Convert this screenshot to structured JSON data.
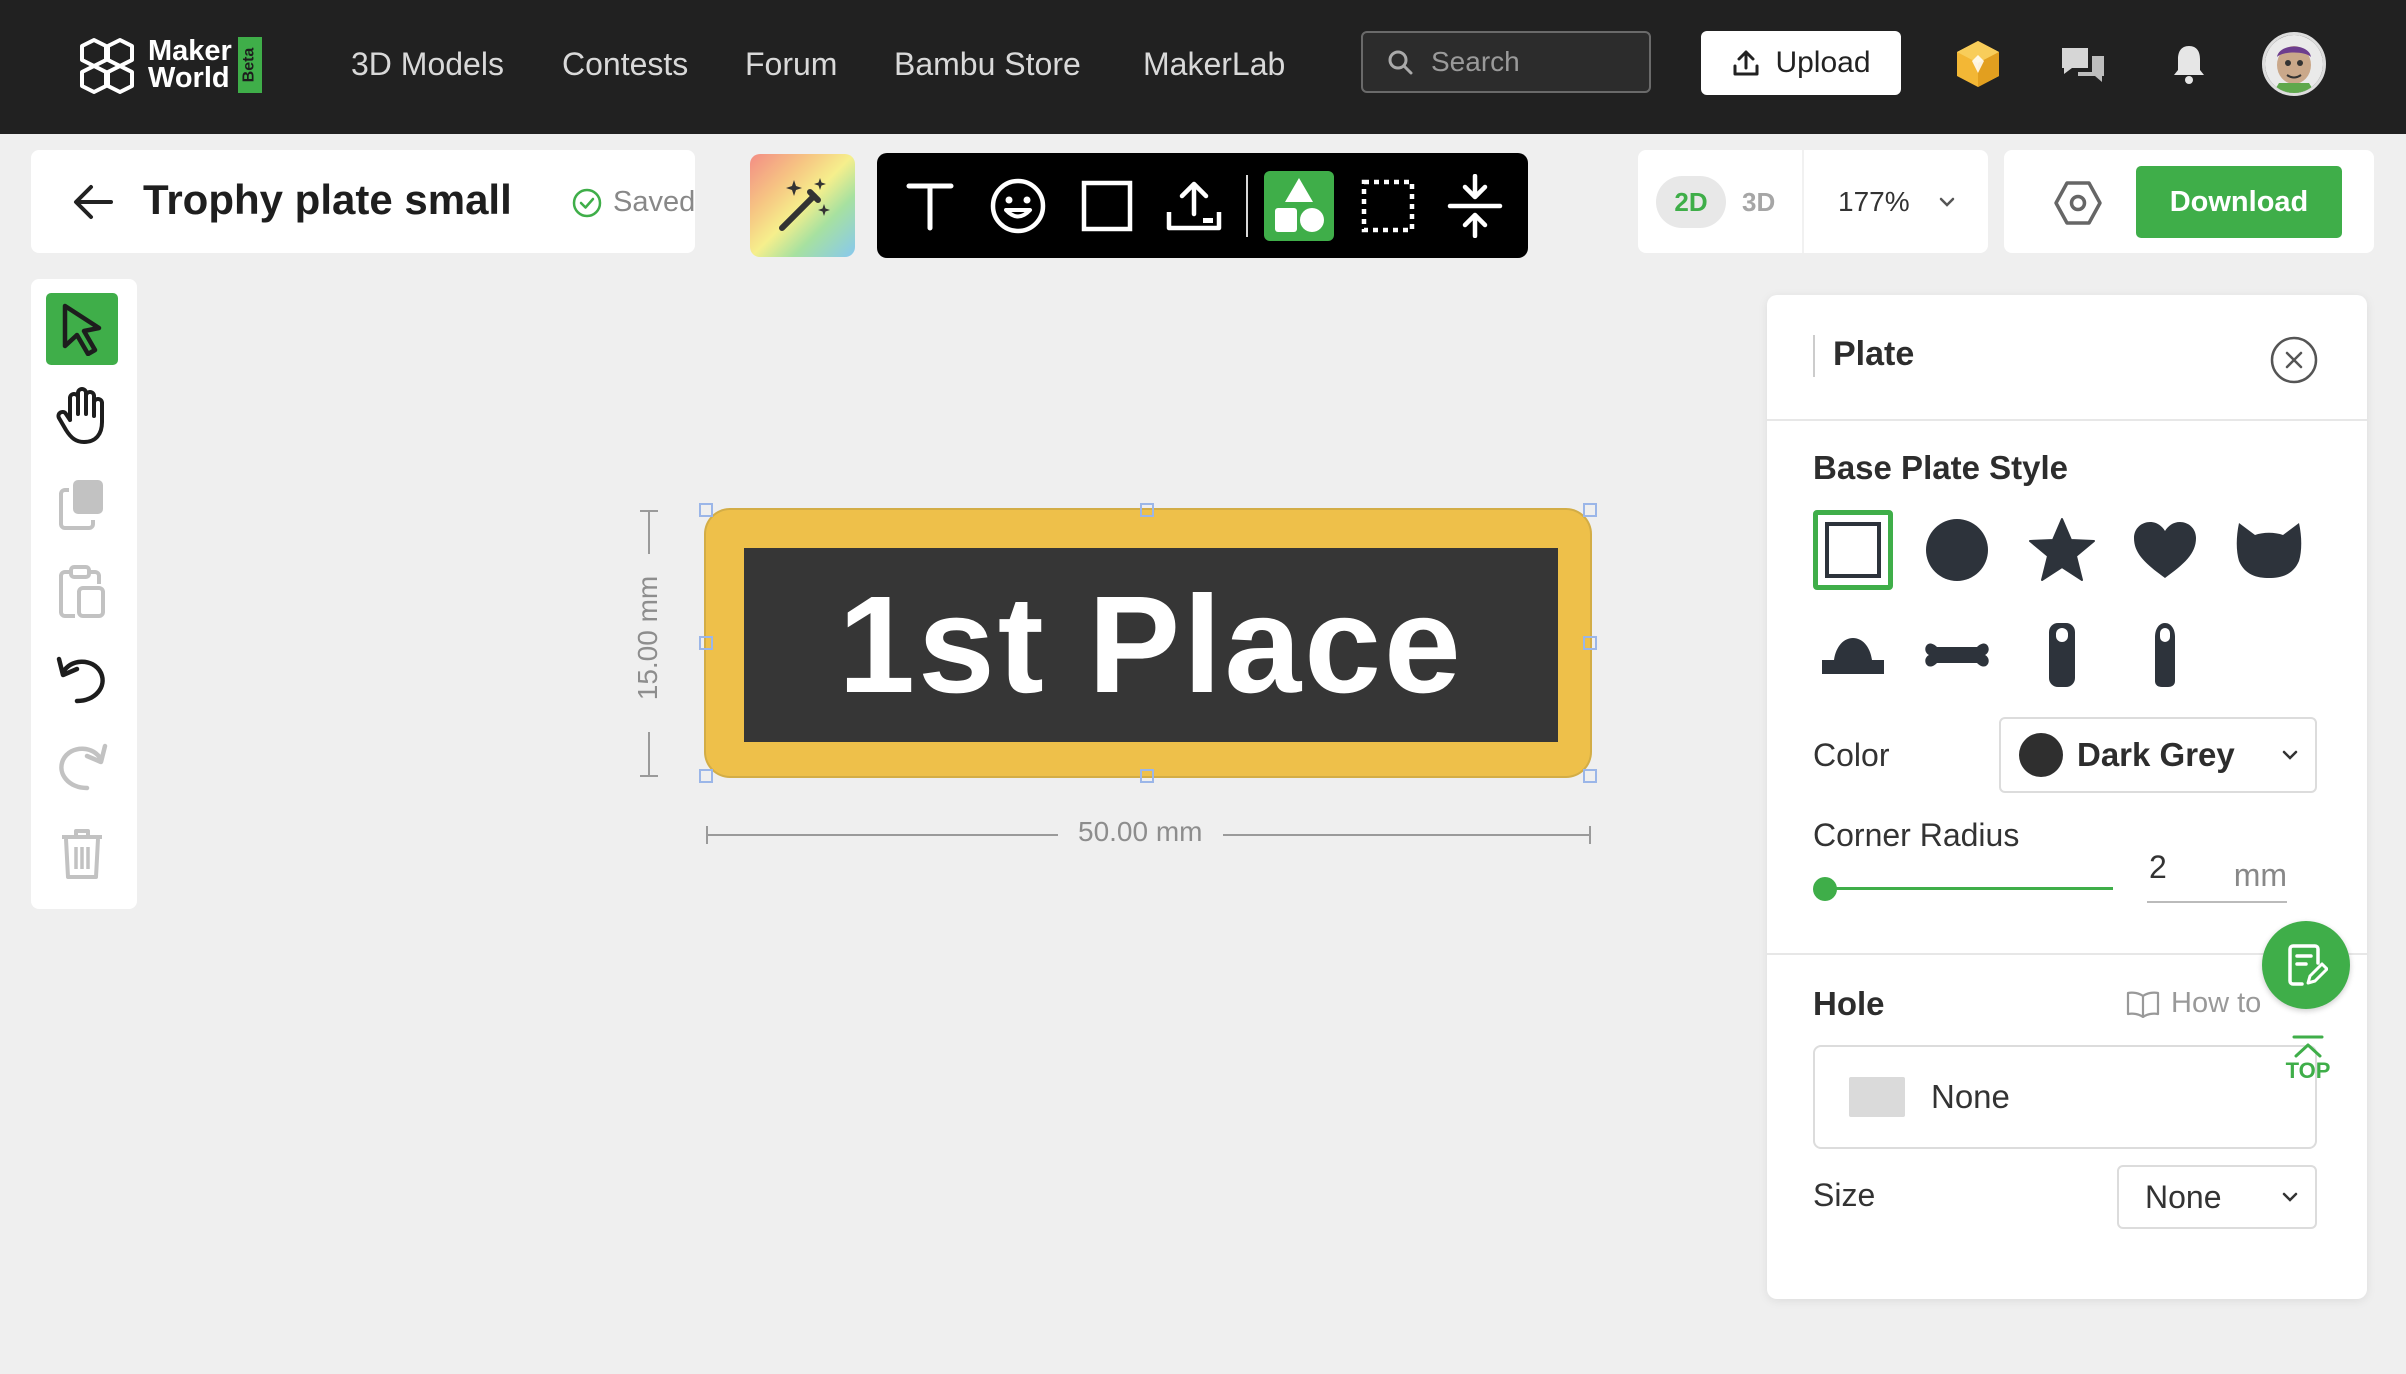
{
  "nav": {
    "logo_line1": "Maker",
    "logo_line2": "World",
    "logo_badge": "Beta",
    "links": [
      "3D Models",
      "Contests",
      "Forum",
      "Bambu Store",
      "MakerLab"
    ],
    "search_placeholder": "Search",
    "upload_label": "Upload"
  },
  "project": {
    "title": "Trophy plate small",
    "save_status": "Saved"
  },
  "view": {
    "mode_2d": "2D",
    "mode_3d": "3D",
    "active_mode": "2D",
    "zoom": "177%"
  },
  "download_label": "Download",
  "canvas": {
    "plate_text": "1st Place",
    "height_label": "15.00 mm",
    "width_label": "50.00 mm",
    "plate_border_color": "#EEC04A",
    "plate_fill_color": "#363636"
  },
  "panel": {
    "title": "Plate",
    "base_style_title": "Base Plate Style",
    "shapes": [
      "square",
      "circle",
      "star",
      "heart",
      "cat",
      "dome",
      "bone",
      "tag-tall",
      "tag-narrow"
    ],
    "selected_shape": "square",
    "color_label": "Color",
    "color_value": "Dark Grey",
    "color_hex": "#2F2F2F",
    "corner_radius_label": "Corner Radius",
    "corner_radius_value": "2",
    "corner_radius_unit": "mm",
    "hole_title": "Hole",
    "howto_label": "How to",
    "hole_value": "None",
    "size_label": "Size",
    "size_value": "None",
    "top_label": "TOP"
  },
  "colors": {
    "accent": "#3FAE49",
    "topbar": "#212121"
  }
}
